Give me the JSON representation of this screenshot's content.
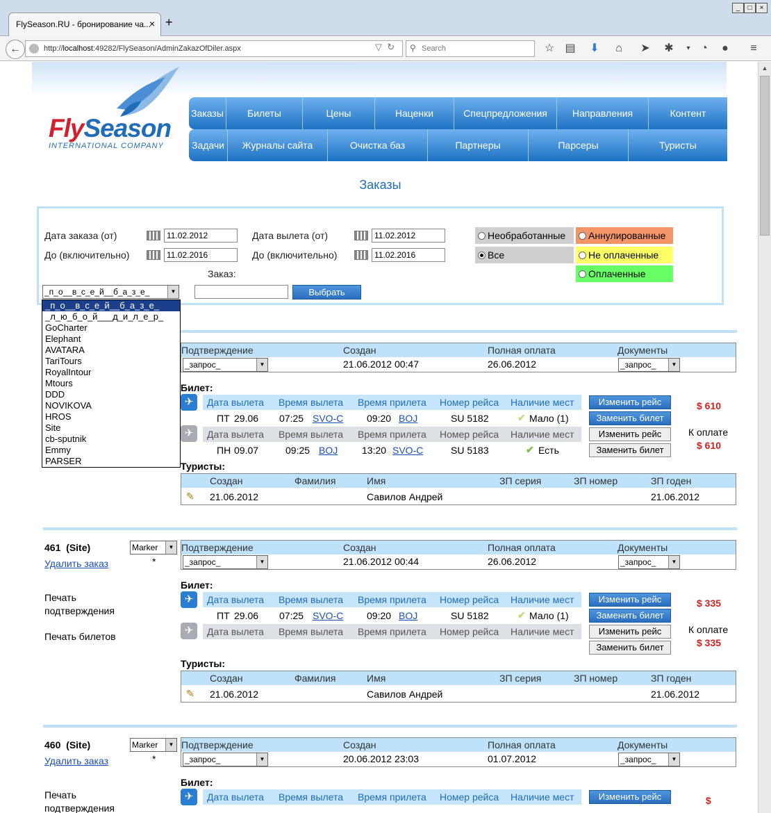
{
  "browser": {
    "tab_title": "FlySeason.RU - бронирование ча...",
    "url_prefix": "http://",
    "url_domain": "localhost",
    "url_rest": ":49282/FlySeason/AdminZakazOfDiler.aspx",
    "search_placeholder": "Search"
  },
  "site": {
    "logo_fly": "Fly",
    "logo_season": "Season",
    "logo_sub": "INTERNATIONAL COMPANY",
    "menu_row1": [
      "Заказы",
      "Билеты",
      "Цены",
      "Наценки",
      "Спецпредложения",
      "Направления",
      "Контент"
    ],
    "menu_row2": [
      "Задачи",
      "Журналы сайта",
      "Очистка баз",
      "Партнеры",
      "Парсеры",
      "Туристы"
    ],
    "page_title": "Заказы"
  },
  "filter": {
    "order_date_from_label": "Дата заказа (от)",
    "order_date_from": "11.02.2012",
    "order_date_to_label": "До (включительно)",
    "order_date_to": "11.02.2016",
    "dep_date_from_label": "Дата вылета (от)",
    "dep_date_from": "11.02.2012",
    "dep_date_to_label": "До (включительно)",
    "dep_date_to": "11.02.2016",
    "order_label": "Заказ:",
    "order_value": "",
    "select_button": "Выбрать",
    "dealer_selected": "_п_о__в_с_е_й__б_а_з_е_",
    "radio_unprocessed": "Необработанные",
    "radio_all": "Все",
    "radio_cancelled": "Аннулированные",
    "radio_unpaid": "Не оплаченные",
    "radio_paid": "Оплаченные",
    "colors": {
      "cancelled": "#f49568",
      "unpaid": "#ffff66",
      "paid": "#66ff66",
      "gray": "#cfcfcf"
    }
  },
  "dropdown_items": [
    "_п_о__в_с_е_й__б_а_з_е_",
    "_л_ю_б_о_й___д_и_л_е_р_",
    "GoCharter",
    "Elephant",
    "AVATARA",
    "TariTours",
    "RoyalIntour",
    "Mtours",
    "DDD",
    "NOVIKOVA",
    "HROS",
    "Site",
    "cb-sputnik",
    "Emmy",
    "PARSER"
  ],
  "labels": {
    "confirm": "Подтверждение",
    "created": "Создан",
    "full_pay": "Полная оплата",
    "docs": "Документы",
    "request": "_запрос_",
    "ticket": "Билет:",
    "dep_date": "Дата вылета",
    "dep_time": "Время вылета",
    "arr_time": "Время прилета",
    "flight_no": "Номер рейса",
    "seats": "Наличие мест",
    "change_flight": "Изменить рейс",
    "replace_ticket": "Заменить билет",
    "to_pay": "К оплате",
    "tourists": "Туристы:",
    "t_created": "Создан",
    "t_surname": "Фамилия",
    "t_name": "Имя",
    "t_series": "ЗП серия",
    "t_number": "ЗП номер",
    "t_valid": "ЗП годен",
    "delete_order": "Удалить заказ",
    "print_confirm": "Печать подтверждения",
    "print_tickets": "Печать билетов",
    "marker": "Marker",
    "asterisk": "*"
  },
  "orders": [
    {
      "created": "21.06.2012 00:47",
      "full_pay": "26.06.2012",
      "price": "$ 610",
      "price2": "$ 610",
      "leg1": {
        "dow": "ПТ",
        "date": "29.06",
        "dep": "07:25",
        "from": "SVO-C",
        "arr": "09:20",
        "to": "BOJ",
        "flight": "SU 5182",
        "seats": "Мало (1)"
      },
      "leg2": {
        "dow": "ПН",
        "date": "09.07",
        "dep": "09:25",
        "from": "BOJ",
        "arr": "13:20",
        "to": "SVO-C",
        "flight": "SU 5183",
        "seats": "Есть"
      },
      "tourist": {
        "created": "21.06.2012",
        "name": "Савилов Андрей",
        "valid": "21.06.2012"
      }
    },
    {
      "id": "461",
      "source": "Site",
      "created": "21.06.2012 00:44",
      "full_pay": "26.06.2012",
      "price": "$ 335",
      "price2": "$ 335",
      "leg1": {
        "dow": "ПТ",
        "date": "29.06",
        "dep": "07:25",
        "from": "SVO-C",
        "arr": "09:20",
        "to": "BOJ",
        "flight": "SU 5182",
        "seats": "Мало (1)"
      },
      "tourist": {
        "created": "21.06.2012",
        "name": "Савилов Андрей",
        "valid": "21.06.2012"
      }
    },
    {
      "id": "460",
      "source": "Site",
      "created": "20.06.2012 23:03",
      "full_pay": "01.07.2012",
      "price": "$"
    }
  ]
}
